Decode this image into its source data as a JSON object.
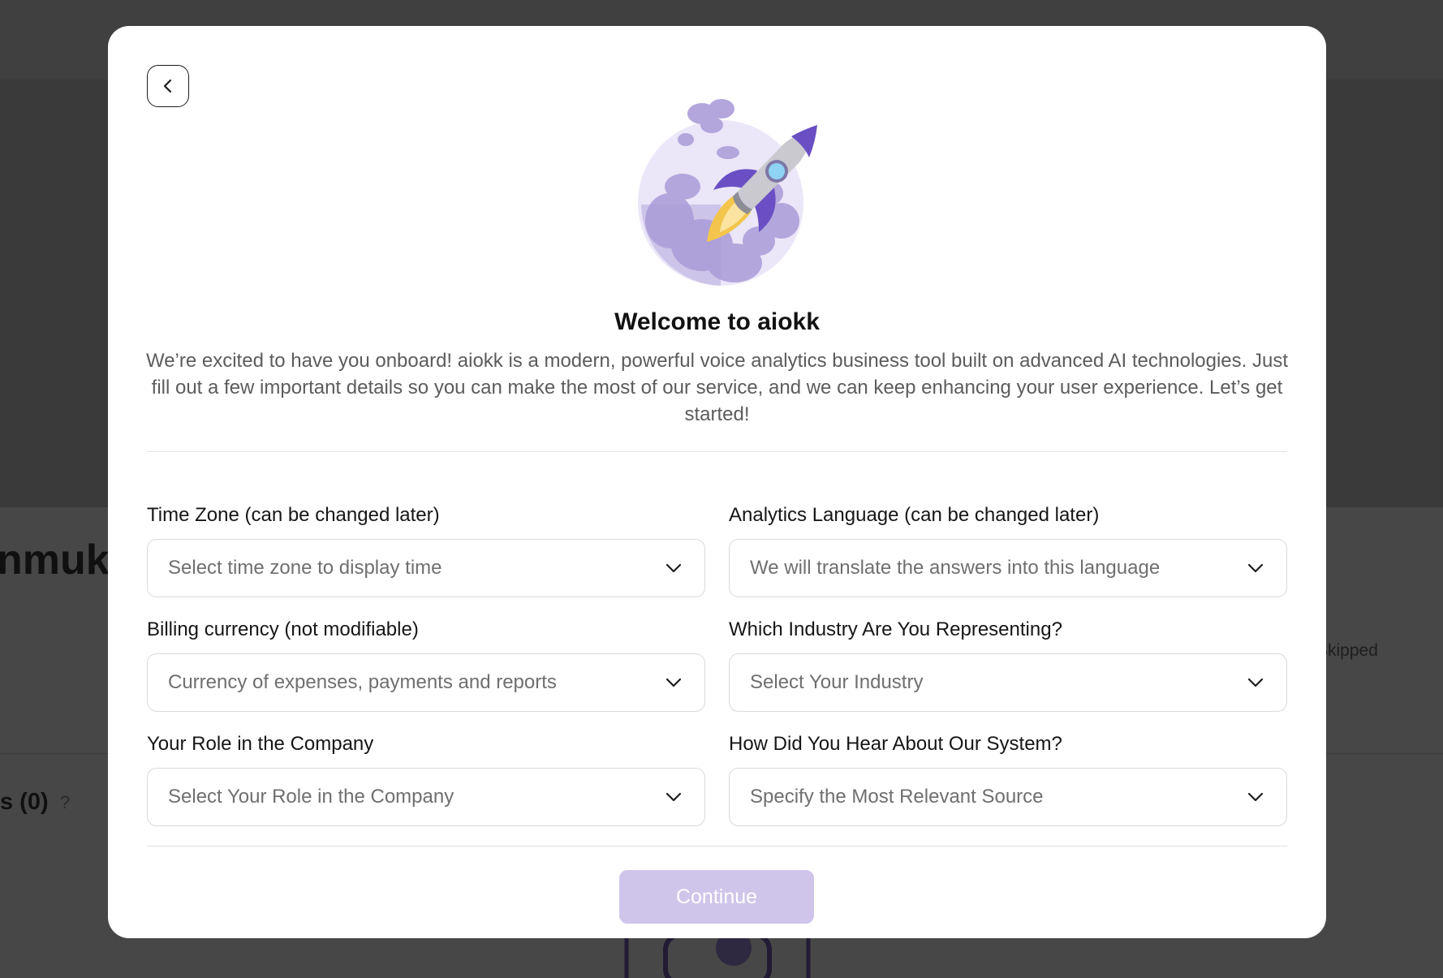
{
  "background": {
    "title_fragment": "nmuki",
    "skipped_label": "Skipped",
    "section_title": "s (0)",
    "help_glyph": "?"
  },
  "modal": {
    "back_icon": "chevron-left-icon",
    "illustration": "rocket-launch-illustration",
    "title": "Welcome to aiokk",
    "intro": "We’re excited to have you onboard! aiokk is a modern, powerful voice analytics business tool built on advanced AI technologies. Just fill out a few important details so you can make the most of our service, and we can keep enhancing your user experience. Let’s get started!",
    "fields": {
      "time_zone": {
        "label": "Time Zone (can be changed later)",
        "placeholder": "Select time zone to display time"
      },
      "analytics_language": {
        "label": "Analytics Language (can be changed later)",
        "placeholder": "We will translate the answers into this language"
      },
      "billing_currency": {
        "label": "Billing currency (not modifiable)",
        "placeholder": "Currency of expenses, payments and reports"
      },
      "industry": {
        "label": "Which Industry Are You Representing?",
        "placeholder": "Select Your Industry"
      },
      "role": {
        "label": "Your Role in the Company",
        "placeholder": "Select Your Role in the Company"
      },
      "source": {
        "label": "How Did You Hear About Our System?",
        "placeholder": "Specify the Most Relevant Source"
      }
    },
    "continue_label": "Continue"
  },
  "colors": {
    "accent": "#cfc5ea",
    "accent_dark": "#6a4fc4",
    "overlay": "#3a3a3a"
  }
}
